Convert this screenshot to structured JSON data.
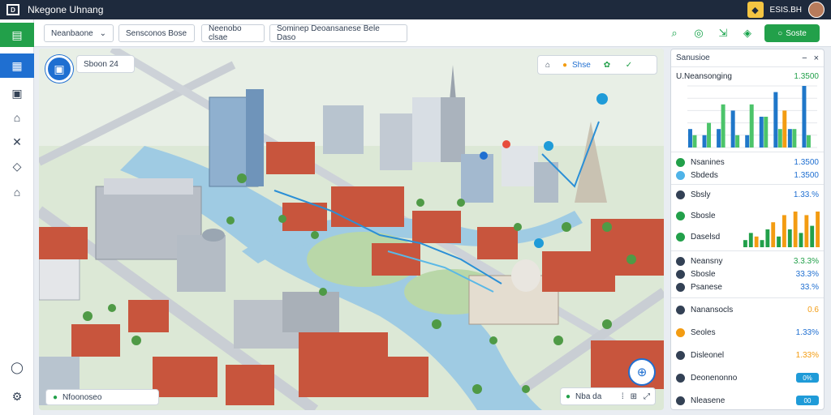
{
  "app": {
    "title": "Nkegone Uhnang",
    "user_label": "ESIS.BH"
  },
  "toolbar": {
    "dropdown_label": "Neanbaone",
    "buttons": [
      "Sensconos Bose",
      "Neenobo clsae",
      "Sominep Deoansanese Bele Daso"
    ],
    "action_label": "Soste"
  },
  "map": {
    "chip_top_left": "Sboon 24",
    "chip_top_right": "Shse",
    "chip_bottom_left": "Nfoonoseo",
    "chip_bottom_right": "Nba da"
  },
  "panel": {
    "header": "Sanusioe",
    "chart_title": "U.Neansonging",
    "chart_value": "1.3500",
    "chart_data": {
      "type": "bar",
      "series": [
        {
          "name": "",
          "color": "#1f77c9",
          "values": [
            0.3,
            0.2,
            0.3,
            0.6,
            0.2,
            0.5,
            0.9,
            0.3,
            1.0
          ]
        },
        {
          "name": "",
          "color": "#4cc46a",
          "values": [
            0.2,
            0.4,
            0.7,
            0.2,
            0.7,
            0.5,
            0.3,
            0.3,
            0.2
          ]
        },
        {
          "name": "",
          "color": "#f39c12",
          "values": [
            0.0,
            0.0,
            0.0,
            0.0,
            0.0,
            0.0,
            0.6,
            0.0,
            0.0
          ]
        }
      ],
      "categories": [
        "",
        "",
        "",
        "",
        "",
        "",
        "",
        "",
        ""
      ]
    },
    "rows_group1": [
      {
        "label": "Nsanines",
        "value": "1.3500",
        "dot": "#22a04a",
        "value_color": "#1f6fd1"
      },
      {
        "label": "Sbdeds",
        "value": "1.3500",
        "dot": "#4fb3e8",
        "value_color": "#1f6fd1"
      }
    ],
    "rows_group2": [
      {
        "label": "Sbsly",
        "value": "1.33.%",
        "dot": "#334155",
        "value_color": "#1f6fd1"
      },
      {
        "label": "Sbosle",
        "value": "",
        "dot": "#22a04a",
        "value_color": "#1f6fd1"
      },
      {
        "label": "Daselsd",
        "value": "",
        "dot": "#22a04a",
        "value_color": "#1f6fd1"
      }
    ],
    "mini_chart": {
      "type": "bar",
      "values": [
        0.2,
        0.4,
        0.3,
        0.2,
        0.5,
        0.7,
        0.3,
        0.9,
        0.5,
        1.0,
        0.4,
        0.9,
        0.6,
        1.0
      ],
      "colors": [
        "#22a04a",
        "#22a04a",
        "#f39c12",
        "#22a04a",
        "#22a04a",
        "#f39c12",
        "#22a04a",
        "#f39c12",
        "#22a04a",
        "#f39c12",
        "#22a04a",
        "#f39c12",
        "#22a04a",
        "#f39c12"
      ]
    },
    "rows_group3": [
      {
        "label": "Neansny",
        "value": "3.3.3%",
        "dot": "#334155",
        "value_color": "#22a04a"
      },
      {
        "label": "Sbosle",
        "value": "33.3%",
        "dot": "#334155",
        "value_color": "#1f6fd1"
      },
      {
        "label": "Psanese",
        "value": "33.%",
        "dot": "#334155",
        "value_color": "#1f6fd1"
      }
    ],
    "rows_group4": [
      {
        "label": "Nanansocls",
        "value": "0.6",
        "dot": "#334155",
        "value_color": "#f39c12",
        "pill": false
      },
      {
        "label": "Seoles",
        "value": "1.33%",
        "dot": "#f39c12",
        "value_color": "#1f6fd1",
        "pill": false
      },
      {
        "label": "Disleonel",
        "value": "1.33%",
        "dot": "#334155",
        "value_color": "#f39c12",
        "pill": false
      },
      {
        "label": "Deonenonno",
        "value": "0%",
        "dot": "#334155",
        "value_color": "#fff",
        "pill": true
      },
      {
        "label": "Nleasene",
        "value": "00",
        "dot": "#334155",
        "value_color": "#fff",
        "pill": true
      }
    ]
  }
}
